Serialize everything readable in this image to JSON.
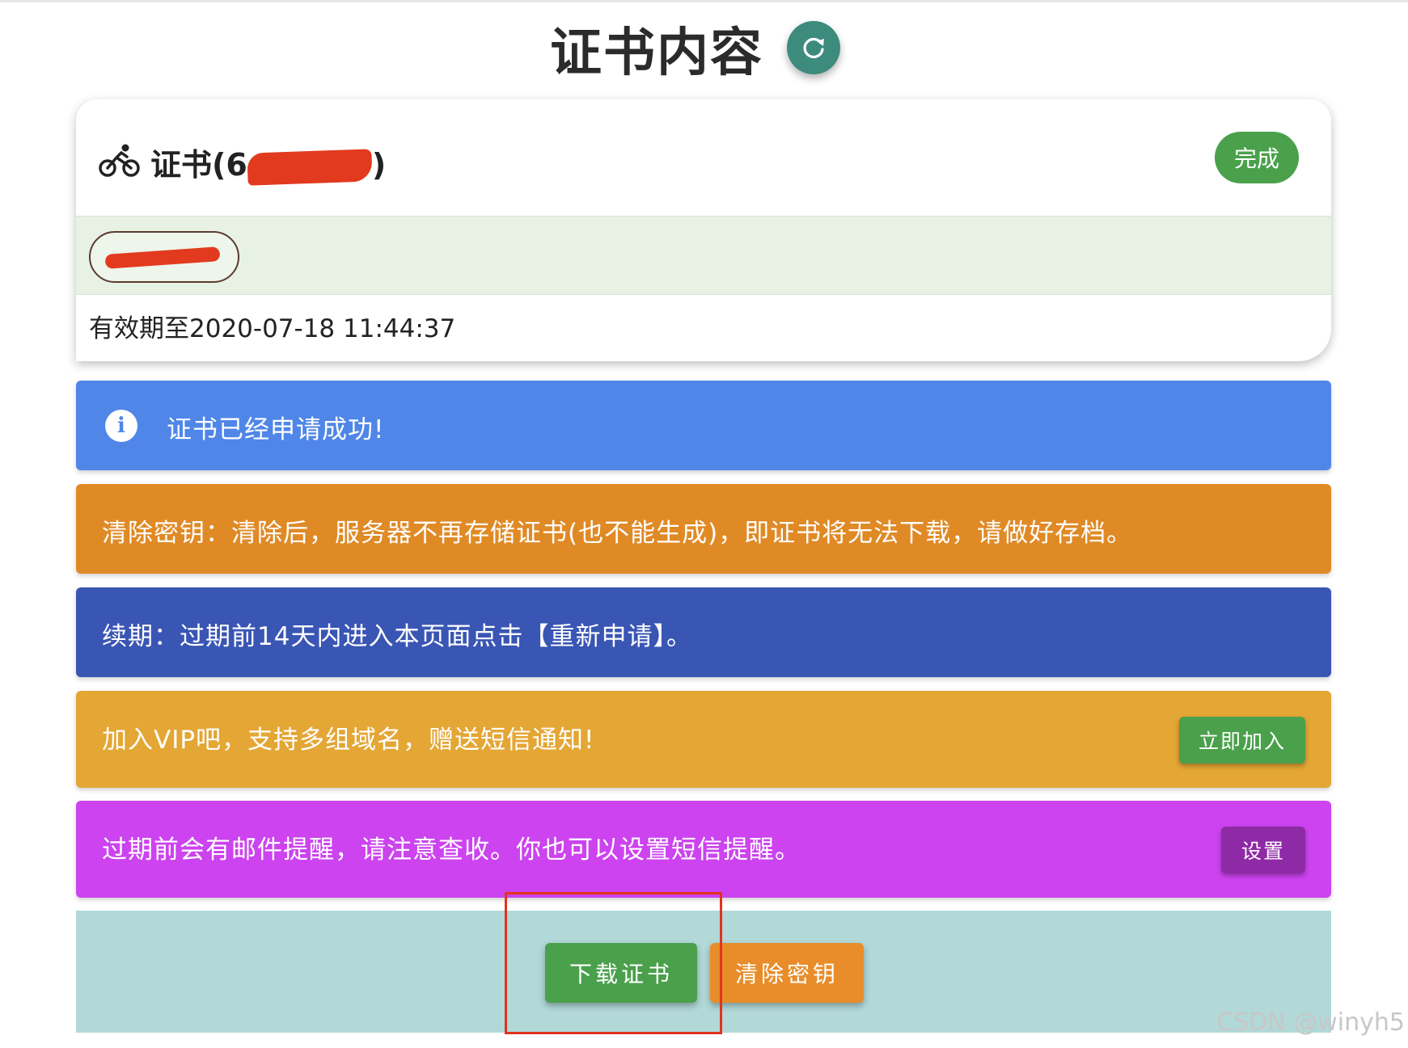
{
  "header": {
    "title": "证书内容",
    "refresh_icon": "refresh-icon"
  },
  "card": {
    "icon": "bike-icon",
    "title_prefix": "证书(6",
    "title_suffix": ")",
    "status": "完成",
    "domain_chip": "",
    "expiry": "有效期至2020-07-18 11:44:37"
  },
  "alerts": {
    "info": "证书已经申请成功!",
    "clear_key": "清除密钥：清除后，服务器不再存储证书(也不能生成)，即证书将无法下载，请做好存档。",
    "renew": "续期：过期前14天内进入本页面点击【重新申请】。",
    "vip": "加入VIP吧，支持多组域名，赠送短信通知!",
    "vip_button": "立即加入",
    "notify": "过期前会有邮件提醒，请注意查收。你也可以设置短信提醒。",
    "notify_button": "设置"
  },
  "actions": {
    "download": "下载证书",
    "clear_key": "清除密钥"
  },
  "watermark": "CSDN @winyh5",
  "colors": {
    "info": "#4f86e8",
    "warning": "#e08a26",
    "indigo": "#3a56b4",
    "amber": "#e4a634",
    "purple": "#cc43ef",
    "success": "#4aa04b",
    "teal": "#3d8b7d",
    "redaction": "#e23a1e"
  }
}
